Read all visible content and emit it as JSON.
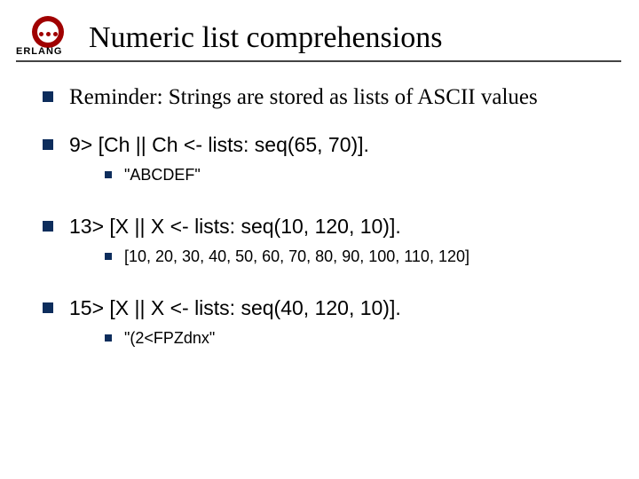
{
  "logo_text": "ERLANG",
  "title": "Numeric list comprehensions",
  "items": [
    {
      "text": "Reminder: Strings are stored as lists of ASCII values",
      "style": "serif",
      "sub": []
    },
    {
      "text": "9> [Ch || Ch <- lists: seq(65, 70)].",
      "style": "sans",
      "sub": [
        {
          "text": "\"ABCDEF\""
        }
      ]
    },
    {
      "text": "13> [X || X <- lists: seq(10, 120, 10)].",
      "style": "sans",
      "sub": [
        {
          "text": "[10, 20, 30, 40, 50, 60, 70, 80, 90, 100, 110, 120]"
        }
      ]
    },
    {
      "text": "15> [X || X <- lists: seq(40, 120, 10)].",
      "style": "sans",
      "sub": [
        {
          "text": "\"(2<FPZdnx\""
        }
      ]
    }
  ]
}
